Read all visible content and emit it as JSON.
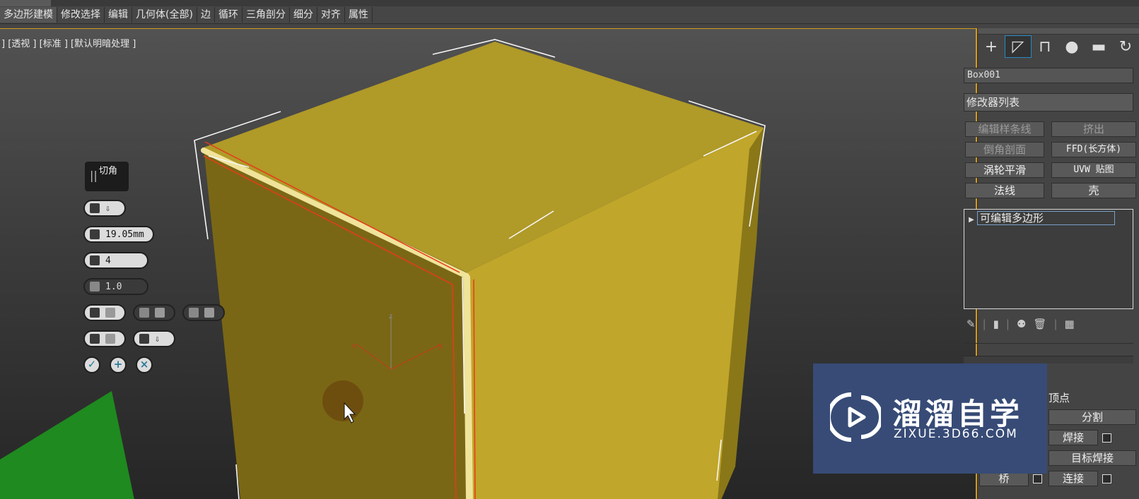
{
  "menubar": {
    "items": [
      "多边形建模",
      "修改选择",
      "编辑",
      "几何体(全部)",
      "边",
      "循环",
      "三角剖分",
      "细分",
      "对齐",
      "属性"
    ]
  },
  "viewport": {
    "label": "] [透视 ] [标准 ] [默认明暗处理 ]",
    "axis": {
      "x": "x",
      "y": "y",
      "z": "z"
    }
  },
  "caddy": {
    "title": "切角",
    "amount": "19.05mm",
    "segments": "4",
    "tension": "1.0"
  },
  "command_panel": {
    "tabs": [
      "create-icon",
      "modify-icon",
      "hierarchy-icon",
      "motion-icon",
      "display-icon"
    ],
    "object_name": "Box001",
    "modifier_list": "修改器列表",
    "modifier_buttons": [
      "编辑样条线",
      "挤出",
      "倒角剖面",
      "FFD(长方体)",
      "涡轮平滑",
      "UVW 贴图",
      "法线",
      "壳"
    ],
    "stack_item": "可编辑多边形",
    "edit_poly": {
      "vertex_label": "顶点",
      "split": "分割",
      "weld": "焊接",
      "target_weld": "目标焊接",
      "bridge": "桥",
      "connect": "连接"
    }
  },
  "watermark": {
    "title": "溜溜自学",
    "subtitle": "ZIXUE.3D66.COM"
  },
  "colors": {
    "selection_border": "#d39b1a",
    "box_top": "#b09a28",
    "box_left": "#7a6715",
    "box_right": "#c2a82b",
    "edge_highlight": "#e83a1a",
    "watermark_bg": "#374b76"
  }
}
